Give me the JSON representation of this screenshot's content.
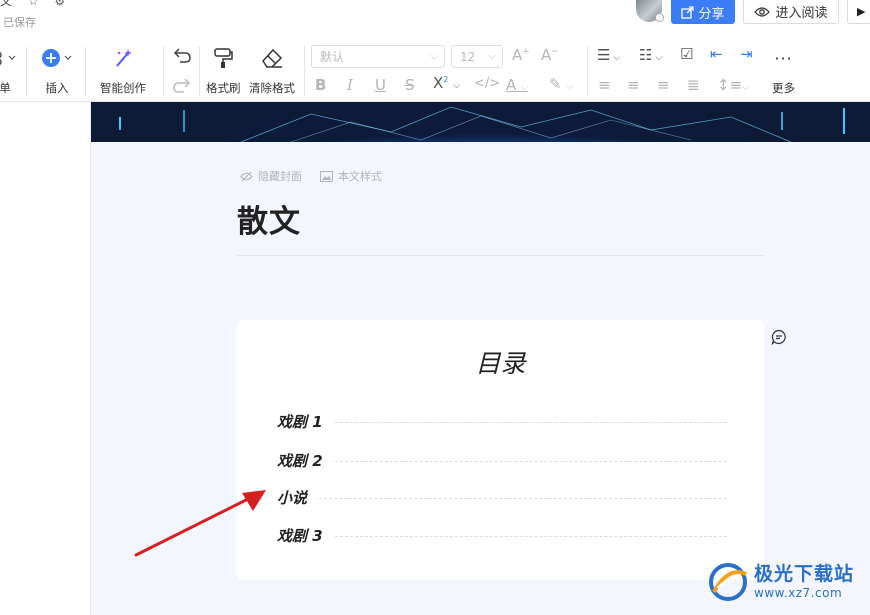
{
  "header": {
    "top_icons": "文 ☆ ⚙",
    "saved_status": "已保存",
    "share_label": "分享",
    "read_label": "进入阅读"
  },
  "toolbar": {
    "list_label": "单",
    "insert_label": "插入",
    "ai_label": "智能创作",
    "format_brush_label": "格式刷",
    "clear_format_label": "清除格式",
    "font_family_value": "默认",
    "font_size_value": "12",
    "more_label": "更多"
  },
  "document": {
    "hide_cover_label": "隐藏封面",
    "text_style_label": "本文样式",
    "title": "散文",
    "toc": {
      "title": "目录",
      "items": [
        "戏剧 1",
        "戏剧 2",
        "小说",
        "戏剧 3"
      ]
    }
  },
  "watermark": {
    "name": "极光下载站",
    "url": "www.xz7.com"
  },
  "colors": {
    "accent": "#3a7df6",
    "doc_background": "#f3f6fc",
    "arrow": "#d42020"
  }
}
